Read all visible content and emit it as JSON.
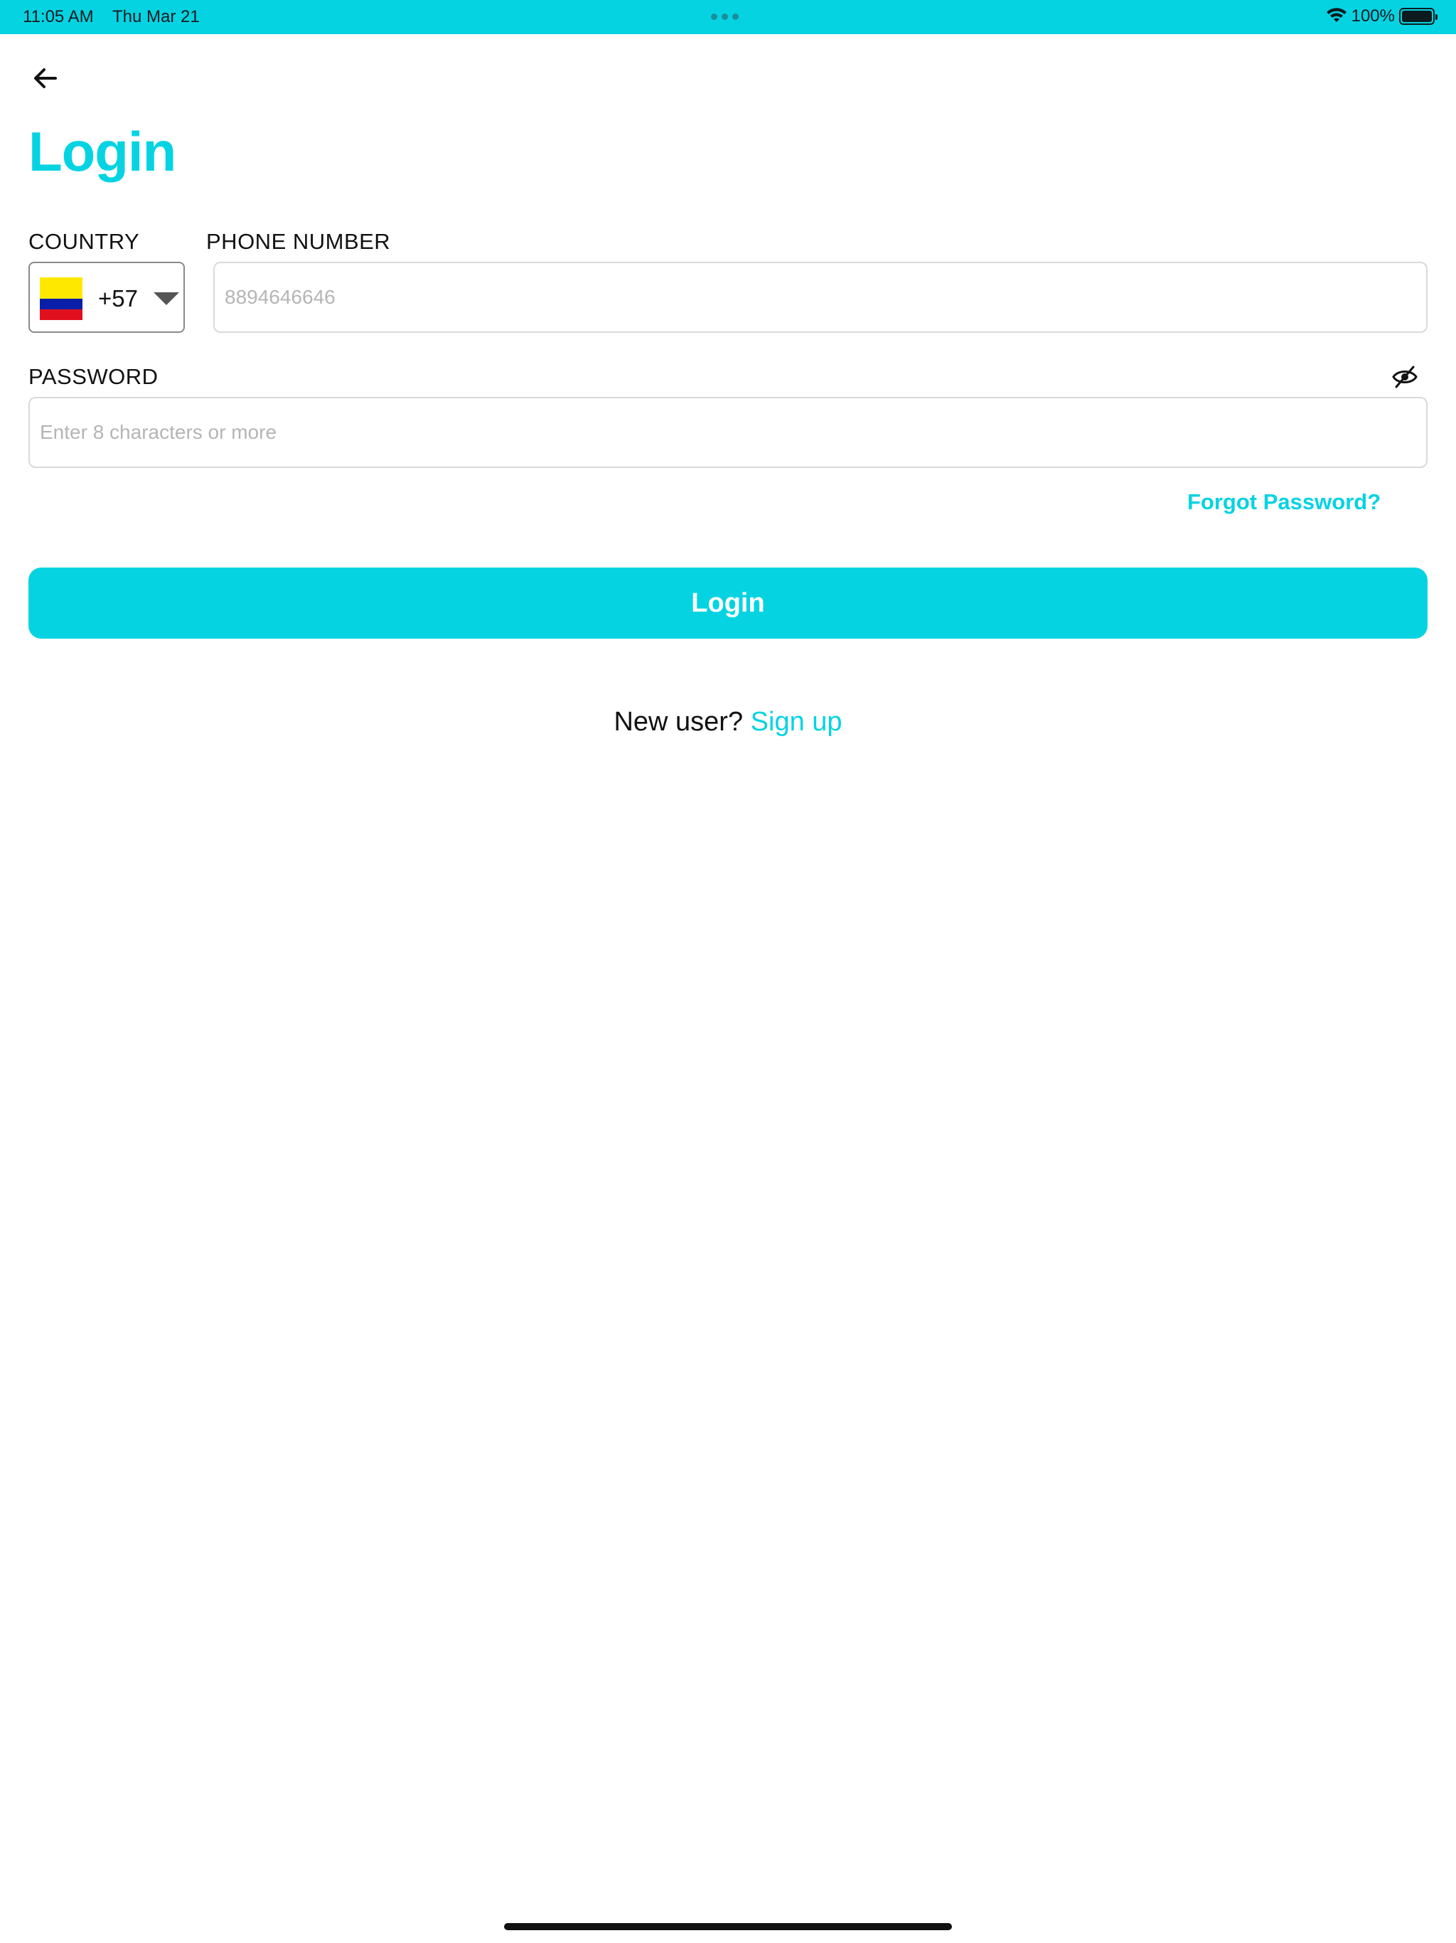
{
  "status_bar": {
    "time": "11:05 AM",
    "date": "Thu Mar 21",
    "battery": "100%"
  },
  "nav": {
    "back_icon": "arrow-left-icon"
  },
  "page": {
    "title": "Login"
  },
  "form": {
    "country_label": "COUNTRY",
    "country_code": "+57",
    "country_flag": "colombia-flag",
    "phone_label": "PHONE NUMBER",
    "phone_placeholder": "8894646646",
    "password_label": "PASSWORD",
    "password_placeholder": "Enter 8 characters or more",
    "password_toggle_icon": "eye-slash-icon",
    "forgot_password": "Forgot Password?",
    "login_button": "Login"
  },
  "footer": {
    "new_user_text": "New user?",
    "signup_link": "Sign up"
  },
  "colors": {
    "accent": "#06D3E2",
    "text": "#111111",
    "border": "#D9D9D9",
    "placeholder": "#B5B5B5"
  }
}
